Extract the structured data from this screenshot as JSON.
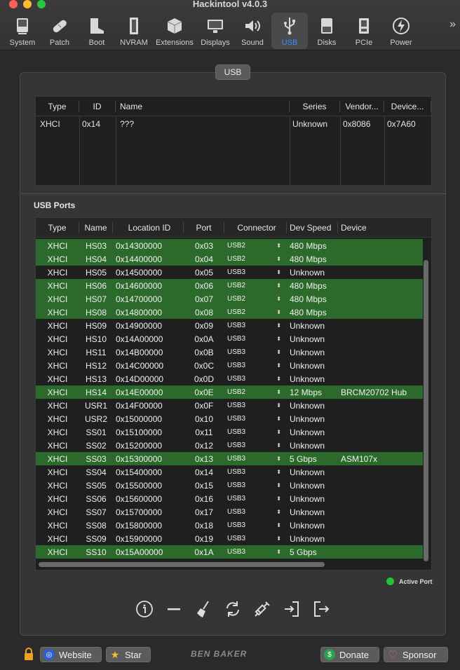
{
  "window": {
    "title": "Hackintool v4.0.3"
  },
  "toolbar": {
    "items": [
      {
        "label": "System",
        "icon": "computer-icon"
      },
      {
        "label": "Patch",
        "icon": "bandage-icon"
      },
      {
        "label": "Boot",
        "icon": "boot-icon"
      },
      {
        "label": "NVRAM",
        "icon": "memory-chip-icon"
      },
      {
        "label": "Extensions",
        "icon": "cube-icon"
      },
      {
        "label": "Displays",
        "icon": "monitor-icon"
      },
      {
        "label": "Sound",
        "icon": "speaker-icon"
      },
      {
        "label": "USB",
        "icon": "usb-icon",
        "active": true
      },
      {
        "label": "Disks",
        "icon": "disk-icon"
      },
      {
        "label": "PCIe",
        "icon": "pcie-card-icon"
      },
      {
        "label": "Power",
        "icon": "lightning-icon"
      }
    ],
    "overflow": "»"
  },
  "panel": {
    "title": "USB"
  },
  "controllers": {
    "columns": [
      "Type",
      "ID",
      "Name",
      "Series",
      "Vendor...",
      "Device..."
    ],
    "rows": [
      {
        "type": "XHCI",
        "id": "0x14",
        "name": "???",
        "series": "Unknown",
        "vendor": "0x8086",
        "device": "0x7A60"
      }
    ]
  },
  "ports": {
    "label": "USB Ports",
    "columns": [
      "Type",
      "Name",
      "Location ID",
      "Port",
      "Connector",
      "Dev Speed",
      "Device"
    ],
    "rows": [
      {
        "type": "XHCI",
        "name": "HS03",
        "loc": "0x14300000",
        "port": "0x03",
        "conn": "USB2",
        "speed": "480 Mbps",
        "device": "",
        "active": true
      },
      {
        "type": "XHCI",
        "name": "HS04",
        "loc": "0x14400000",
        "port": "0x04",
        "conn": "USB2",
        "speed": "480 Mbps",
        "device": "",
        "active": true
      },
      {
        "type": "XHCI",
        "name": "HS05",
        "loc": "0x14500000",
        "port": "0x05",
        "conn": "USB3",
        "speed": "Unknown",
        "device": "",
        "active": false
      },
      {
        "type": "XHCI",
        "name": "HS06",
        "loc": "0x14600000",
        "port": "0x06",
        "conn": "USB2",
        "speed": "480 Mbps",
        "device": "",
        "active": true
      },
      {
        "type": "XHCI",
        "name": "HS07",
        "loc": "0x14700000",
        "port": "0x07",
        "conn": "USB2",
        "speed": "480 Mbps",
        "device": "",
        "active": true
      },
      {
        "type": "XHCI",
        "name": "HS08",
        "loc": "0x14800000",
        "port": "0x08",
        "conn": "USB2",
        "speed": "480 Mbps",
        "device": "",
        "active": true
      },
      {
        "type": "XHCI",
        "name": "HS09",
        "loc": "0x14900000",
        "port": "0x09",
        "conn": "USB3",
        "speed": "Unknown",
        "device": "",
        "active": false
      },
      {
        "type": "XHCI",
        "name": "HS10",
        "loc": "0x14A00000",
        "port": "0x0A",
        "conn": "USB3",
        "speed": "Unknown",
        "device": "",
        "active": false
      },
      {
        "type": "XHCI",
        "name": "HS11",
        "loc": "0x14B00000",
        "port": "0x0B",
        "conn": "USB3",
        "speed": "Unknown",
        "device": "",
        "active": false
      },
      {
        "type": "XHCI",
        "name": "HS12",
        "loc": "0x14C00000",
        "port": "0x0C",
        "conn": "USB3",
        "speed": "Unknown",
        "device": "",
        "active": false
      },
      {
        "type": "XHCI",
        "name": "HS13",
        "loc": "0x14D00000",
        "port": "0x0D",
        "conn": "USB3",
        "speed": "Unknown",
        "device": "",
        "active": false
      },
      {
        "type": "XHCI",
        "name": "HS14",
        "loc": "0x14E00000",
        "port": "0x0E",
        "conn": "USB2",
        "speed": "12 Mbps",
        "device": "BRCM20702 Hub",
        "active": true
      },
      {
        "type": "XHCI",
        "name": "USR1",
        "loc": "0x14F00000",
        "port": "0x0F",
        "conn": "USB3",
        "speed": "Unknown",
        "device": "",
        "active": false
      },
      {
        "type": "XHCI",
        "name": "USR2",
        "loc": "0x15000000",
        "port": "0x10",
        "conn": "USB3",
        "speed": "Unknown",
        "device": "",
        "active": false
      },
      {
        "type": "XHCI",
        "name": "SS01",
        "loc": "0x15100000",
        "port": "0x11",
        "conn": "USB3",
        "speed": "Unknown",
        "device": "",
        "active": false
      },
      {
        "type": "XHCI",
        "name": "SS02",
        "loc": "0x15200000",
        "port": "0x12",
        "conn": "USB3",
        "speed": "Unknown",
        "device": "",
        "active": false
      },
      {
        "type": "XHCI",
        "name": "SS03",
        "loc": "0x15300000",
        "port": "0x13",
        "conn": "USB3",
        "speed": "5 Gbps",
        "device": "ASM107x",
        "active": true
      },
      {
        "type": "XHCI",
        "name": "SS04",
        "loc": "0x15400000",
        "port": "0x14",
        "conn": "USB3",
        "speed": "Unknown",
        "device": "",
        "active": false
      },
      {
        "type": "XHCI",
        "name": "SS05",
        "loc": "0x15500000",
        "port": "0x15",
        "conn": "USB3",
        "speed": "Unknown",
        "device": "",
        "active": false
      },
      {
        "type": "XHCI",
        "name": "SS06",
        "loc": "0x15600000",
        "port": "0x16",
        "conn": "USB3",
        "speed": "Unknown",
        "device": "",
        "active": false
      },
      {
        "type": "XHCI",
        "name": "SS07",
        "loc": "0x15700000",
        "port": "0x17",
        "conn": "USB3",
        "speed": "Unknown",
        "device": "",
        "active": false
      },
      {
        "type": "XHCI",
        "name": "SS08",
        "loc": "0x15800000",
        "port": "0x18",
        "conn": "USB3",
        "speed": "Unknown",
        "device": "",
        "active": false
      },
      {
        "type": "XHCI",
        "name": "SS09",
        "loc": "0x15900000",
        "port": "0x19",
        "conn": "USB3",
        "speed": "Unknown",
        "device": "",
        "active": false
      },
      {
        "type": "XHCI",
        "name": "SS10",
        "loc": "0x15A00000",
        "port": "0x1A",
        "conn": "USB3",
        "speed": "5 Gbps",
        "device": "",
        "active": true
      }
    ]
  },
  "legend": {
    "label": "Active Port",
    "color": "#22c33a"
  },
  "actions": [
    "info-icon",
    "minus-icon",
    "broom-icon",
    "refresh-icon",
    "syringe-icon",
    "import-icon",
    "export-icon"
  ],
  "footer": {
    "website": "Website",
    "star": "Star",
    "brand": "BEN BAKER",
    "donate": "Donate",
    "sponsor": "Sponsor"
  },
  "colors": {
    "active_row": "#2c6a2c",
    "accent": "#3a8dff"
  }
}
